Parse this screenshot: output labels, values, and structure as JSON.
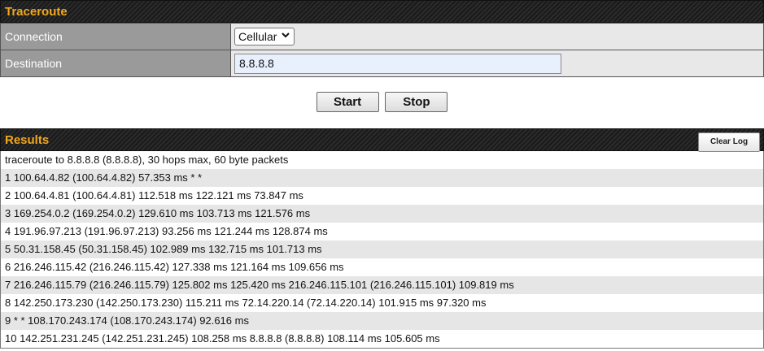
{
  "traceroute": {
    "title": "Traceroute",
    "connection_label": "Connection",
    "connection_value": "Cellular",
    "destination_label": "Destination",
    "destination_value": "8.8.8.8"
  },
  "buttons": {
    "start": "Start",
    "stop": "Stop"
  },
  "results": {
    "title": "Results",
    "clear_label": "Clear Log",
    "lines": [
      "traceroute to 8.8.8.8 (8.8.8.8), 30 hops max, 60 byte packets",
      "1 100.64.4.82 (100.64.4.82) 57.353 ms * *",
      "2 100.64.4.81 (100.64.4.81) 112.518 ms 122.121 ms 73.847 ms",
      "3 169.254.0.2 (169.254.0.2) 129.610 ms 103.713 ms 121.576 ms",
      "4 191.96.97.213 (191.96.97.213) 93.256 ms 121.244 ms 128.874 ms",
      "5 50.31.158.45 (50.31.158.45) 102.989 ms 132.715 ms 101.713 ms",
      "6 216.246.115.42 (216.246.115.42) 127.338 ms 121.164 ms 109.656 ms",
      "7 216.246.115.79 (216.246.115.79) 125.802 ms 125.420 ms 216.246.115.101 (216.246.115.101) 109.819 ms",
      "8 142.250.173.230 (142.250.173.230) 115.211 ms 72.14.220.14 (72.14.220.14) 101.915 ms 97.320 ms",
      "9 * * 108.170.243.174 (108.170.243.174) 92.616 ms",
      "10 142.251.231.245 (142.251.231.245) 108.258 ms 8.8.8.8 (8.8.8.8) 108.114 ms 105.605 ms"
    ]
  },
  "colors": {
    "header_title": "#f2a81d",
    "label_bg": "#9a9a9a",
    "input_bg": "#e8f0fe"
  }
}
